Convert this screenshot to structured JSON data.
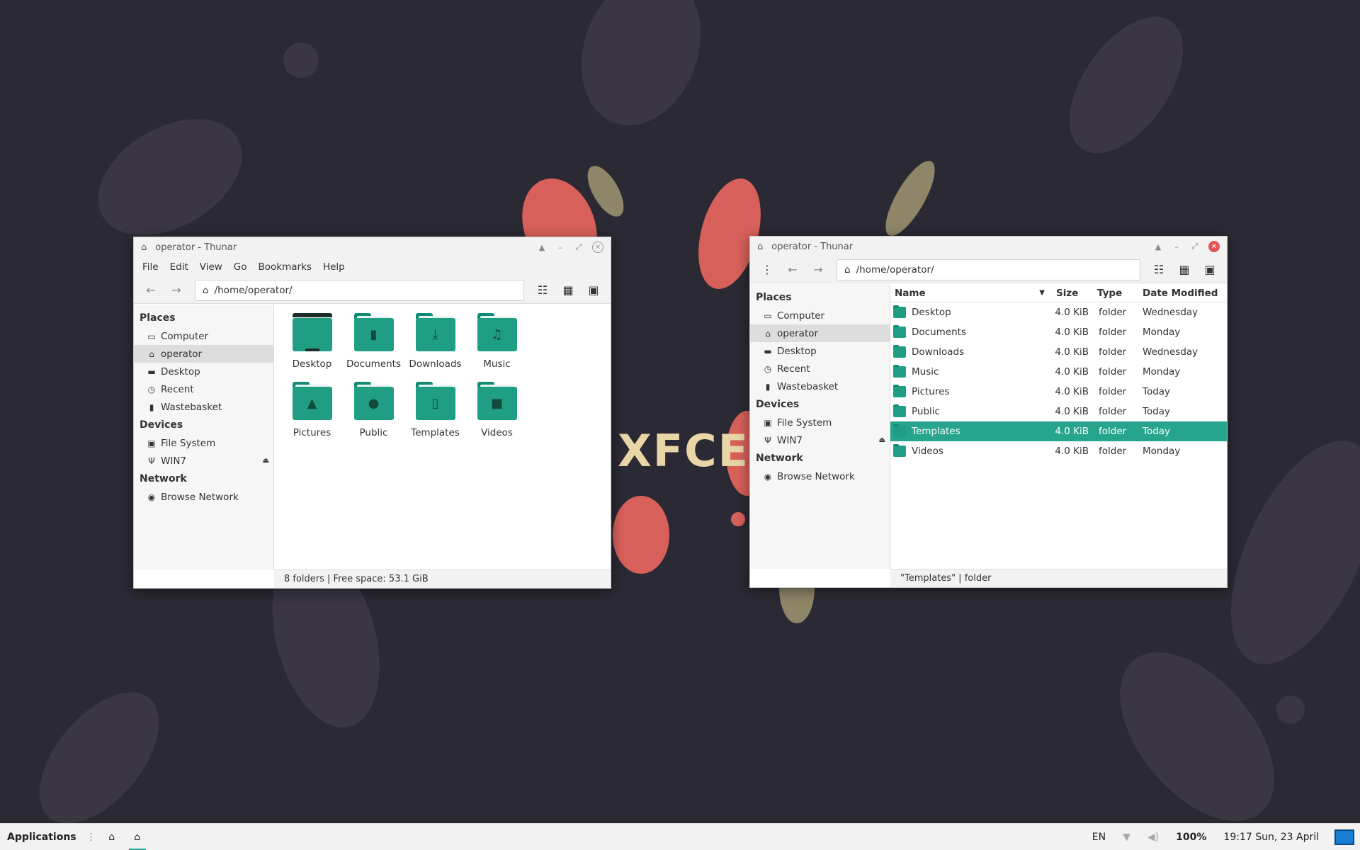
{
  "colors": {
    "accent": "#26a48c",
    "folder": "#1f9e83",
    "desktop": "#2b2933",
    "close_red": "#e05555"
  },
  "wallpaper": {
    "logo_text": "XFCE"
  },
  "left_window": {
    "title": "operator - Thunar",
    "menu": [
      "File",
      "Edit",
      "View",
      "Go",
      "Bookmarks",
      "Help"
    ],
    "path": "/home/operator/",
    "sidebar": {
      "places_header": "Places",
      "places": [
        "Computer",
        "operator",
        "Desktop",
        "Recent",
        "Wastebasket"
      ],
      "devices_header": "Devices",
      "devices": [
        "File System",
        "WIN7"
      ],
      "network_header": "Network",
      "network": [
        "Browse Network"
      ]
    },
    "icons": [
      {
        "label": "Desktop",
        "icon": "desktop-folder-icon"
      },
      {
        "label": "Documents",
        "icon": "document-glyph"
      },
      {
        "label": "Downloads",
        "icon": "download-arrow"
      },
      {
        "label": "Music",
        "icon": "music-note"
      },
      {
        "label": "Pictures",
        "icon": "picture-glyph"
      },
      {
        "label": "Public",
        "icon": "person-glyph"
      },
      {
        "label": "Templates",
        "icon": "template-page"
      },
      {
        "label": "Videos",
        "icon": "video-camera"
      }
    ],
    "status": "8 folders  |  Free space: 53.1 GiB"
  },
  "right_window": {
    "title": "operator - Thunar",
    "path": "/home/operator/",
    "sidebar": {
      "places_header": "Places",
      "places": [
        "Computer",
        "operator",
        "Desktop",
        "Recent",
        "Wastebasket"
      ],
      "devices_header": "Devices",
      "devices": [
        "File System",
        "WIN7"
      ],
      "network_header": "Network",
      "network": [
        "Browse Network"
      ]
    },
    "columns": {
      "name": "Name",
      "size": "Size",
      "type": "Type",
      "date": "Date Modified"
    },
    "rows": [
      {
        "name": "Desktop",
        "size": "4.0 KiB",
        "type": "folder",
        "date": "Wednesday"
      },
      {
        "name": "Documents",
        "size": "4.0 KiB",
        "type": "folder",
        "date": "Monday"
      },
      {
        "name": "Downloads",
        "size": "4.0 KiB",
        "type": "folder",
        "date": "Wednesday"
      },
      {
        "name": "Music",
        "size": "4.0 KiB",
        "type": "folder",
        "date": "Monday"
      },
      {
        "name": "Pictures",
        "size": "4.0 KiB",
        "type": "folder",
        "date": "Today"
      },
      {
        "name": "Public",
        "size": "4.0 KiB",
        "type": "folder",
        "date": "Today"
      },
      {
        "name": "Templates",
        "size": "4.0 KiB",
        "type": "folder",
        "date": "Today"
      },
      {
        "name": "Videos",
        "size": "4.0 KiB",
        "type": "folder",
        "date": "Monday"
      }
    ],
    "selected_row": "Templates",
    "status": "\"Templates\"  |  folder"
  },
  "panel": {
    "applications": "Applications",
    "keyboard": "EN",
    "volume": "100%",
    "clock": "19:17 Sun, 23 April"
  }
}
